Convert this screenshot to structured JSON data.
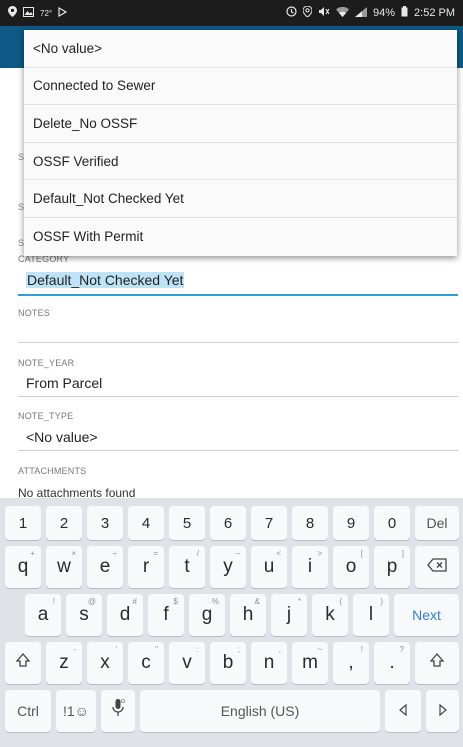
{
  "status_bar": {
    "left_icons": [
      "location-icon",
      "image-icon",
      "temp",
      "play-icon"
    ],
    "temp": "72°",
    "battery": "94%",
    "time": "2:52 PM"
  },
  "dropdown": {
    "options": [
      "<No value>",
      "Connected to Sewer",
      "Delete_No OSSF",
      "OSSF Verified",
      "Default_Not Checked Yet",
      "OSSF With Permit"
    ]
  },
  "form": {
    "hidden_label_letters": [
      "S",
      "S",
      "S"
    ],
    "category": {
      "label": "CATEGORY",
      "value": "Default_Not Checked Yet"
    },
    "notes": {
      "label": "NOTES",
      "value": ""
    },
    "note_year": {
      "label": "NOTE_YEAR",
      "value": "From Parcel"
    },
    "note_type": {
      "label": "NOTE_TYPE",
      "value": "<No value>"
    },
    "attachments": {
      "label": "ATTACHMENTS",
      "value": "No attachments found"
    }
  },
  "keyboard": {
    "row1": [
      "1",
      "2",
      "3",
      "4",
      "5",
      "6",
      "7",
      "8",
      "9",
      "0"
    ],
    "row1_del": "Del",
    "row2": [
      {
        "k": "q",
        "h": "+"
      },
      {
        "k": "w",
        "h": "×"
      },
      {
        "k": "e",
        "h": "÷"
      },
      {
        "k": "r",
        "h": "="
      },
      {
        "k": "t",
        "h": "/"
      },
      {
        "k": "y",
        "h": "–"
      },
      {
        "k": "u",
        "h": "<"
      },
      {
        "k": "i",
        "h": ">"
      },
      {
        "k": "o",
        "h": "["
      },
      {
        "k": "p",
        "h": "]"
      }
    ],
    "row3": [
      {
        "k": "a",
        "h": "!"
      },
      {
        "k": "s",
        "h": "@"
      },
      {
        "k": "d",
        "h": "#"
      },
      {
        "k": "f",
        "h": "$"
      },
      {
        "k": "g",
        "h": "%"
      },
      {
        "k": "h",
        "h": "&"
      },
      {
        "k": "j",
        "h": "*"
      },
      {
        "k": "k",
        "h": "("
      },
      {
        "k": "l",
        "h": ")"
      }
    ],
    "next": "Next",
    "row4": [
      {
        "k": "z",
        "h": "-"
      },
      {
        "k": "x",
        "h": "'"
      },
      {
        "k": "c",
        "h": "\""
      },
      {
        "k": "v",
        "h": ":"
      },
      {
        "k": "b",
        "h": ";"
      },
      {
        "k": "n",
        "h": ","
      },
      {
        "k": "m",
        "h": "~"
      }
    ],
    "row4_punct": [
      ",",
      ".",
      "!",
      "?"
    ],
    "ctrl": "Ctrl",
    "symbols": "!1☺",
    "space": "English (US)"
  },
  "colors": {
    "app_bar": "#0e5a86",
    "selection": "#bfe3f6",
    "accent": "#2e7fd0"
  }
}
